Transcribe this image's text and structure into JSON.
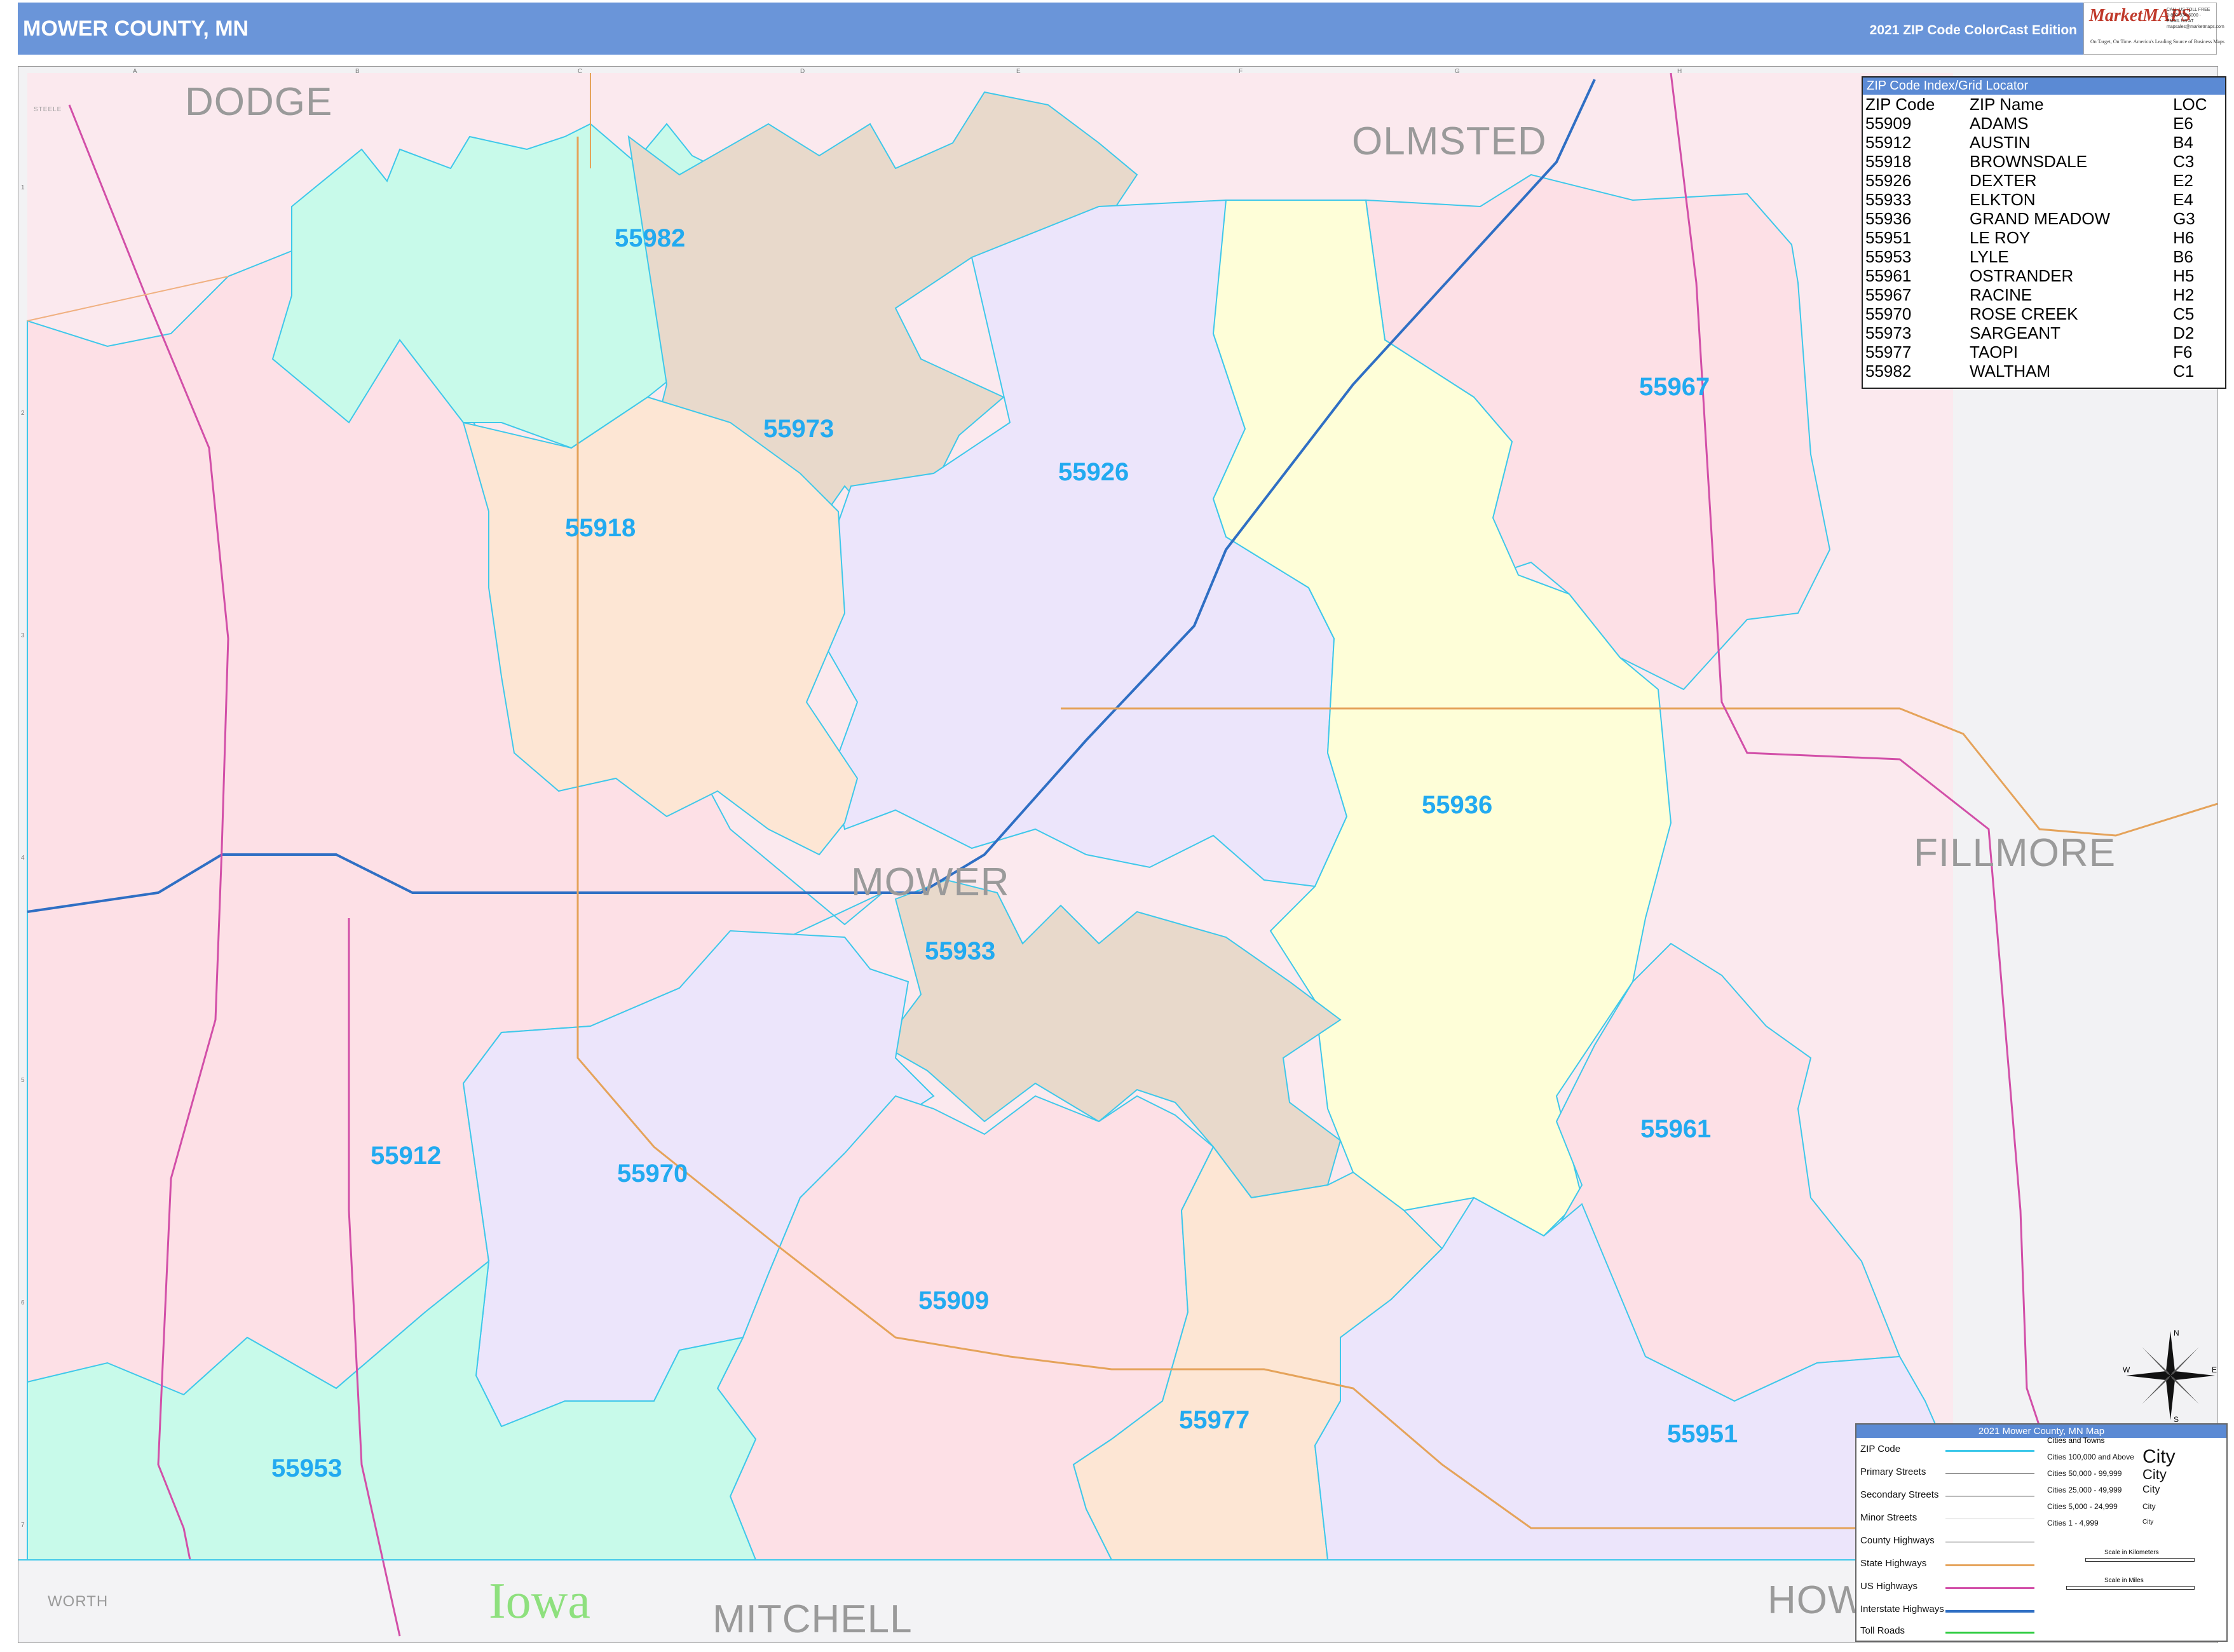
{
  "header": {
    "title": "MOWER COUNTY, MN",
    "edition": "2021 ZIP Code ColorCast Edition",
    "logo_text": "MarketMAPS",
    "logo_tagline": "On Target, On Time. America's Leading Source of Business Maps",
    "logo_contact": "CALL US TOLL FREE 1-800-334-6000 · EMAIL US AT mapsales@marketmaps.com"
  },
  "grid": {
    "columns": [
      "A",
      "B",
      "C",
      "D",
      "E",
      "F",
      "G",
      "H"
    ],
    "rows": [
      "1",
      "2",
      "3",
      "4",
      "5",
      "6",
      "7"
    ]
  },
  "counties": {
    "dodge": "DODGE",
    "olmsted": "OLMSTED",
    "fillmore": "FILLMORE",
    "mower": "MOWER",
    "mitchell": "MITCHELL",
    "howard": "HOW",
    "worth": "WORTH",
    "steele": "STEELE"
  },
  "state_label": "Iowa",
  "zip_labels": {
    "z55982": "55982",
    "z55973": "55973",
    "z55926": "55926",
    "z55967": "55967",
    "z55918": "55918",
    "z55936": "55936",
    "z55933": "55933",
    "z55912": "55912",
    "z55970": "55970",
    "z55961": "55961",
    "z55909": "55909",
    "z55953": "55953",
    "z55977": "55977",
    "z55951": "55951"
  },
  "zip_colors": {
    "pink": "#fde0e6",
    "mint": "#c8faea",
    "tan": "#e8d9cb",
    "lavender": "#ece5fb",
    "peach": "#fde6d4",
    "yellow": "#fefed8",
    "boundary": "#3ec8ea"
  },
  "zip_index": {
    "title": "ZIP Code Index/Grid Locator",
    "columns": [
      "ZIP Code",
      "ZIP Name",
      "LOC"
    ],
    "rows": [
      [
        "55909",
        "ADAMS",
        "E6"
      ],
      [
        "55912",
        "AUSTIN",
        "B4"
      ],
      [
        "55918",
        "BROWNSDALE",
        "C3"
      ],
      [
        "55926",
        "DEXTER",
        "E2"
      ],
      [
        "55933",
        "ELKTON",
        "E4"
      ],
      [
        "55936",
        "GRAND MEADOW",
        "G3"
      ],
      [
        "55951",
        "LE ROY",
        "H6"
      ],
      [
        "55953",
        "LYLE",
        "B6"
      ],
      [
        "55961",
        "OSTRANDER",
        "H5"
      ],
      [
        "55967",
        "RACINE",
        "H2"
      ],
      [
        "55970",
        "ROSE CREEK",
        "C5"
      ],
      [
        "55973",
        "SARGEANT",
        "D2"
      ],
      [
        "55977",
        "TAOPI",
        "F6"
      ],
      [
        "55982",
        "WALTHAM",
        "C1"
      ]
    ]
  },
  "legend": {
    "title": "2021 Mower County, MN Map",
    "items": [
      "ZIP Code",
      "Primary Streets",
      "Secondary Streets",
      "Minor Streets",
      "County Highways",
      "State Highways",
      "US Highways",
      "Interstate Highways",
      "Toll Roads"
    ],
    "cities_title": "Cities and Towns",
    "cities": [
      "Cities 100,000 and Above",
      "Cities 50,000 - 99,999",
      "Cities 25,000 - 49,999",
      "Cities 5,000 - 24,999",
      "Cities 1 - 4,999"
    ],
    "city_word": "City",
    "scale_km": "Scale in Kilometers",
    "scale_mi": "Scale in Miles"
  },
  "compass": {
    "n": "N",
    "s": "S",
    "e": "E",
    "w": "W"
  }
}
